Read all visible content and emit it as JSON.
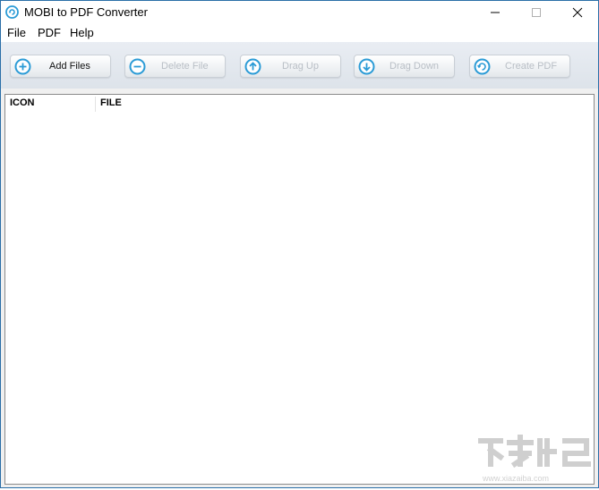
{
  "window": {
    "title": "MOBI to PDF Converter"
  },
  "menu": {
    "file": "File",
    "pdf": "PDF",
    "help": "Help"
  },
  "toolbar": {
    "add_files": "Add Files",
    "delete_file": "Delete File",
    "drag_up": "Drag Up",
    "drag_down": "Drag Down",
    "create_pdf": "Create PDF"
  },
  "list": {
    "columns": [
      "ICON",
      "FILE"
    ]
  },
  "watermark": {
    "text": "www.xiazaiba.com"
  },
  "colors": {
    "accent": "#2b9bd6",
    "disabled_text": "#b8bec5"
  }
}
